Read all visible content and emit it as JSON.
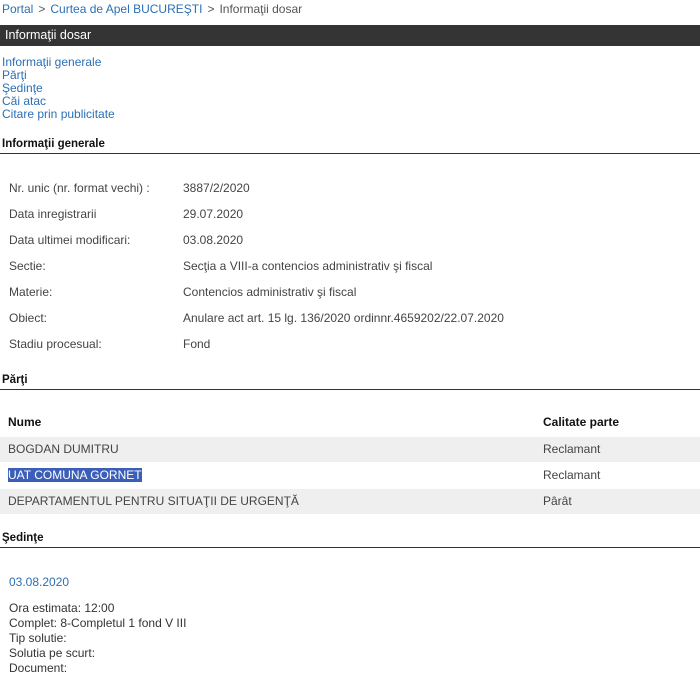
{
  "breadcrumb": {
    "items": [
      "Portal",
      "Curtea de Apel BUCUREŞTI",
      "Informaţii dosar"
    ],
    "separator": ">"
  },
  "page_title": "Informaţii dosar",
  "subnav": [
    "Informaţii generale",
    "Părţi",
    "Şedinţe",
    "Căi atac",
    "Citare prin publicitate"
  ],
  "general": {
    "heading": "Informaţii generale",
    "rows": [
      {
        "label": "Nr. unic (nr. format vechi) :",
        "value": "3887/2/2020"
      },
      {
        "label": "Data inregistrarii",
        "value": "29.07.2020"
      },
      {
        "label": "Data ultimei modificari:",
        "value": "03.08.2020"
      },
      {
        "label": "Sectie:",
        "value": "Secţia a VIII-a contencios administrativ şi fiscal"
      },
      {
        "label": "Materie:",
        "value": "Contencios administrativ şi fiscal"
      },
      {
        "label": "Obiect:",
        "value": "Anulare act art. 15 lg. 136/2020 ordinnr.4659202/22.07.2020"
      },
      {
        "label": "Stadiu procesual:",
        "value": "Fond"
      }
    ]
  },
  "parties": {
    "heading": "Părţi",
    "columns": {
      "name": "Nume",
      "role": "Calitate parte"
    },
    "rows": [
      {
        "name": "BOGDAN DUMITRU",
        "role": "Reclamant",
        "selected": false
      },
      {
        "name": "UAT COMUNA GORNET",
        "role": "Reclamant",
        "selected": true
      },
      {
        "name": "DEPARTAMENTUL PENTRU SITUAŢII DE URGENŢĂ",
        "role": "Pârât",
        "selected": false
      }
    ]
  },
  "hearings": {
    "heading": "Şedinţe",
    "date": "03.08.2020",
    "lines": [
      "Ora estimata: 12:00",
      "Complet: 8-Completul 1 fond V III",
      "Tip solutie:",
      "Solutia pe scurt:",
      "Document:"
    ]
  },
  "colors": {
    "link": "#2b6fb6",
    "title_bar": "#343434",
    "row_alt": "#efefef",
    "selection": "#3b5fb8"
  }
}
